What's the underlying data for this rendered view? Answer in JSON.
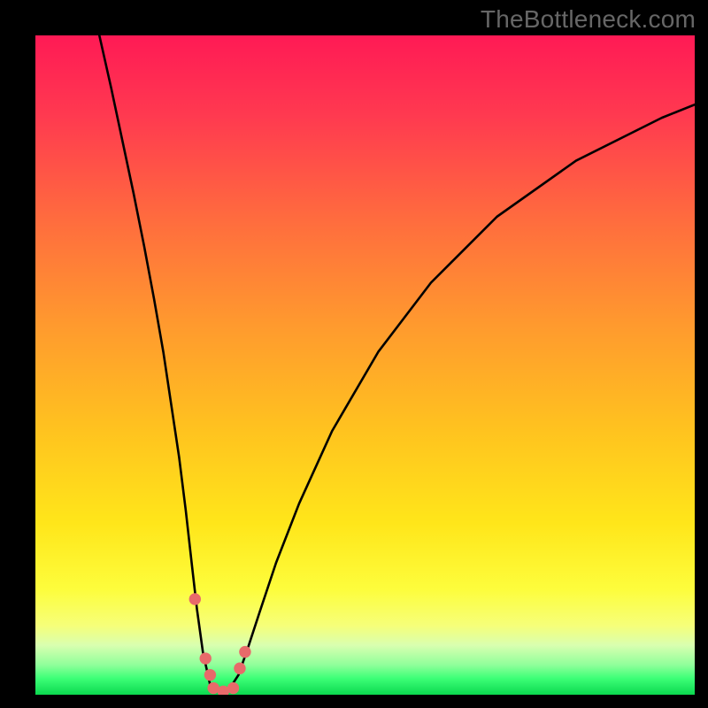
{
  "watermark": "TheBottleneck.com",
  "chart_data": {
    "type": "line",
    "title": "",
    "xlabel": "",
    "ylabel": "",
    "x_range": [
      0,
      100
    ],
    "y_range": [
      0,
      100
    ],
    "note": "V-shaped bottleneck curve over a vertical red→orange→yellow→green gradient. Curve minimum near x≈27 where it touches the green band.",
    "curve_points": [
      {
        "x": 9.7,
        "y": 100.0
      },
      {
        "x": 11.5,
        "y": 92.0
      },
      {
        "x": 13.2,
        "y": 84.0
      },
      {
        "x": 14.9,
        "y": 76.0
      },
      {
        "x": 16.5,
        "y": 68.0
      },
      {
        "x": 18.0,
        "y": 60.0
      },
      {
        "x": 19.4,
        "y": 52.0
      },
      {
        "x": 20.6,
        "y": 44.0
      },
      {
        "x": 21.8,
        "y": 36.0
      },
      {
        "x": 22.8,
        "y": 28.0
      },
      {
        "x": 23.7,
        "y": 20.0
      },
      {
        "x": 24.5,
        "y": 13.0
      },
      {
        "x": 25.4,
        "y": 6.5
      },
      {
        "x": 26.5,
        "y": 1.5
      },
      {
        "x": 28.0,
        "y": 0.3
      },
      {
        "x": 29.5,
        "y": 1.0
      },
      {
        "x": 30.8,
        "y": 3.0
      },
      {
        "x": 32.2,
        "y": 7.0
      },
      {
        "x": 34.0,
        "y": 12.5
      },
      {
        "x": 36.5,
        "y": 20.0
      },
      {
        "x": 40.0,
        "y": 29.0
      },
      {
        "x": 45.0,
        "y": 40.0
      },
      {
        "x": 52.0,
        "y": 52.0
      },
      {
        "x": 60.0,
        "y": 62.5
      },
      {
        "x": 70.0,
        "y": 72.5
      },
      {
        "x": 82.0,
        "y": 81.0
      },
      {
        "x": 95.0,
        "y": 87.5
      },
      {
        "x": 100.0,
        "y": 89.5
      }
    ],
    "markers": [
      {
        "x": 24.2,
        "y": 14.5
      },
      {
        "x": 25.8,
        "y": 5.5
      },
      {
        "x": 26.5,
        "y": 3.0
      },
      {
        "x": 27.0,
        "y": 1.0
      },
      {
        "x": 28.5,
        "y": 0.5
      },
      {
        "x": 30.0,
        "y": 1.0
      },
      {
        "x": 31.0,
        "y": 4.0
      },
      {
        "x": 31.8,
        "y": 6.5
      }
    ],
    "gradient_stops": [
      {
        "offset": 0.0,
        "color": "#ff1a55"
      },
      {
        "offset": 0.12,
        "color": "#ff3950"
      },
      {
        "offset": 0.28,
        "color": "#ff6c3e"
      },
      {
        "offset": 0.44,
        "color": "#ff9a2e"
      },
      {
        "offset": 0.6,
        "color": "#ffc31f"
      },
      {
        "offset": 0.74,
        "color": "#ffe61a"
      },
      {
        "offset": 0.84,
        "color": "#fdfd3c"
      },
      {
        "offset": 0.895,
        "color": "#f6ff79"
      },
      {
        "offset": 0.925,
        "color": "#d9ffb0"
      },
      {
        "offset": 0.955,
        "color": "#8fff9a"
      },
      {
        "offset": 0.975,
        "color": "#3dff77"
      },
      {
        "offset": 1.0,
        "color": "#0bd94f"
      }
    ]
  }
}
